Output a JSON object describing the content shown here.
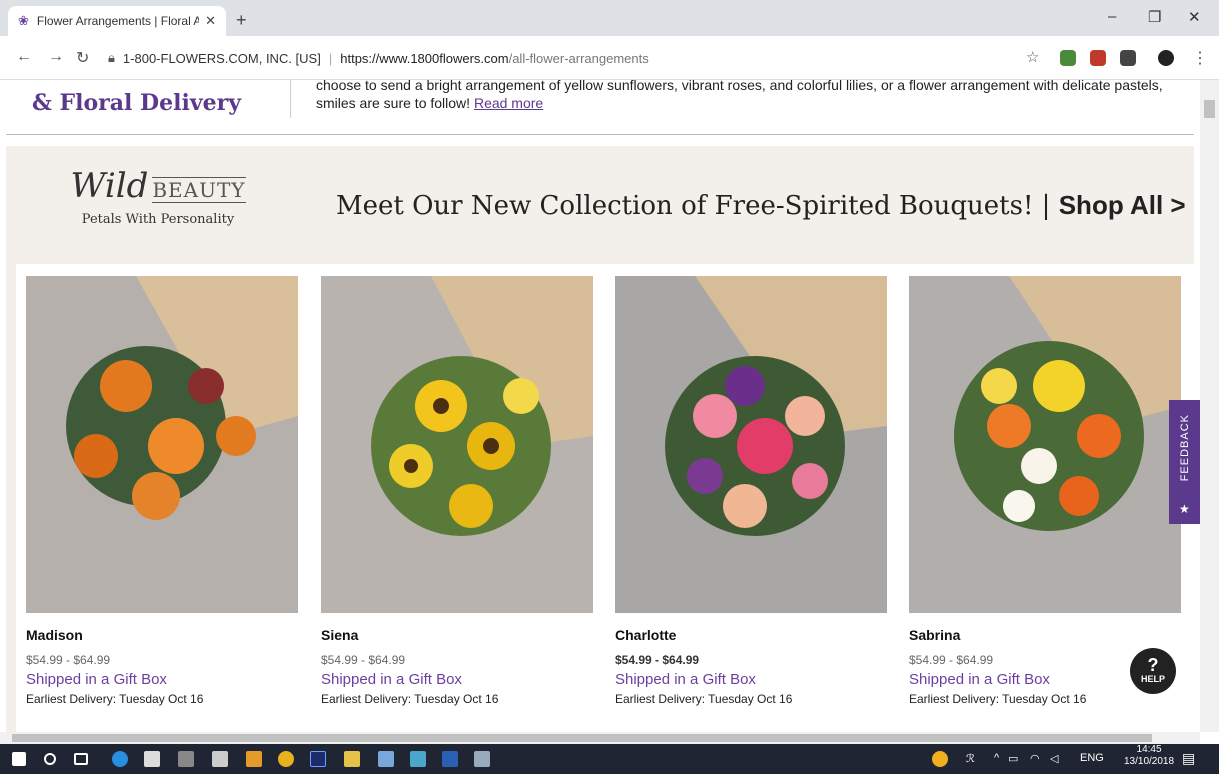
{
  "browser": {
    "tab_title": "Flower Arrangements | Floral Arr",
    "url_org": "1-800-FLOWERS.COM, INC. [US]",
    "url_host": "https://www.1800flowers.com",
    "url_path": "/all-flower-arrangements"
  },
  "header": {
    "title_line": "& Floral Delivery",
    "description": "choose to send a bright arrangement of yellow sunflowers, vibrant roses, and colorful lilies, or a flower arrangement with delicate pastels, smiles are sure to follow!",
    "read_more": "Read more"
  },
  "promo": {
    "logo_wild": "Wild",
    "logo_beauty": "BEAUTY",
    "logo_tagline": "Petals With Personality",
    "headline": "Meet Our New Collection of Free-Spirited Bouquets! |",
    "shop_all": "Shop All >"
  },
  "products": [
    {
      "name": "Madison",
      "price": "$54.99 - $64.99",
      "gift": "Shipped in a Gift Box",
      "delivery": "Earliest Delivery: Tuesday Oct 16"
    },
    {
      "name": "Siena",
      "price": "$54.99 - $64.99",
      "gift": "Shipped in a Gift Box",
      "delivery": "Earliest Delivery: Tuesday Oct 16"
    },
    {
      "name": "Charlotte",
      "price": "$54.99 - $64.99",
      "gift": "Shipped in a Gift Box",
      "delivery": "Earliest Delivery: Tuesday Oct 16"
    },
    {
      "name": "Sabrina",
      "price": "$54.99 - $64.99",
      "gift": "Shipped in a Gift Box",
      "delivery": "Earliest Delivery: Tuesday Oct 16"
    }
  ],
  "widgets": {
    "feedback": "FEEDBACK",
    "help": "HELP"
  },
  "taskbar": {
    "lang": "ENG",
    "time": "14:45",
    "date": "13/10/2018"
  },
  "colors": {
    "brand_purple": "#5b3a8e",
    "promo_bg": "#f3efea"
  }
}
